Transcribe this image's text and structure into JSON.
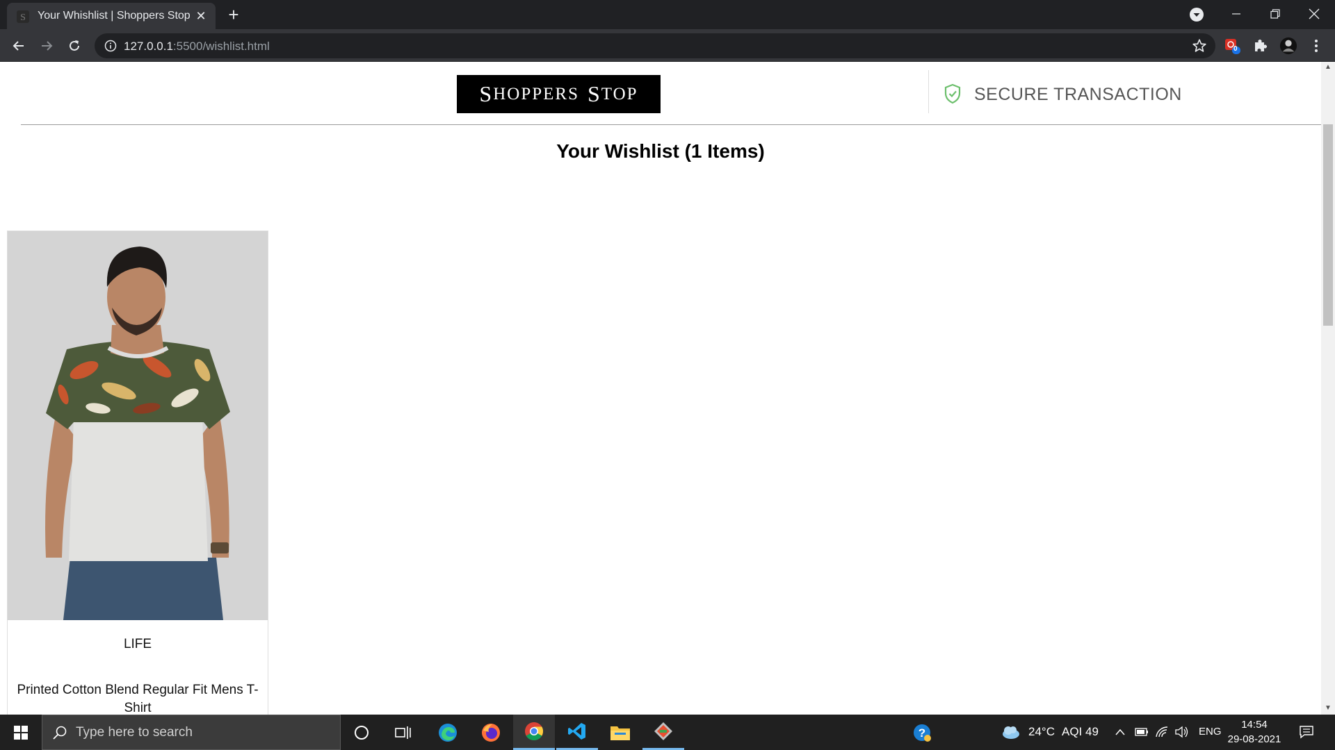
{
  "browser": {
    "tab_title": "Your Whishlist | Shoppers Stop",
    "url_host": "127.0.0.1",
    "url_path": ":5500/wishlist.html",
    "extension_badge": "0"
  },
  "header": {
    "logo_text_cap1": "S",
    "logo_text_rest1": "HOPPERS",
    "logo_text_cap2": "S",
    "logo_text_rest2": "TOP",
    "secure_text": "SECURE TRANSACTION"
  },
  "wishlist": {
    "title": "Your Wishlist (1 Items)",
    "items": [
      {
        "brand": "LIFE",
        "name": "Printed Cotton Blend Regular Fit Mens T-Shirt"
      }
    ]
  },
  "taskbar": {
    "search_placeholder": "Type here to search",
    "weather": "24°C",
    "aqi": "AQI 49",
    "language": "ENG",
    "time": "14:54",
    "date": "29-08-2021"
  },
  "colors": {
    "chrome_dark": "#202124",
    "chrome_toolbar": "#35363a",
    "secure_green": "#4caf50",
    "taskbar": "#202020",
    "accent_blue": "#76b9ed"
  }
}
